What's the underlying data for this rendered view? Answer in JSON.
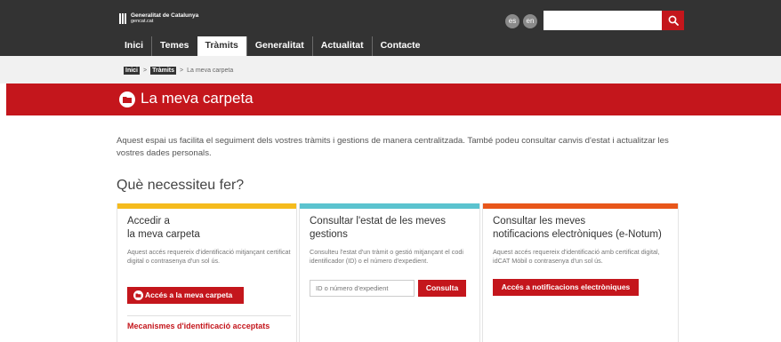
{
  "header": {
    "logo_line1": "Generalitat de Catalunya",
    "logo_line2": "gencat.cat",
    "lang_es": "es",
    "lang_en": "en",
    "search_placeholder": "",
    "nav": [
      "Inici",
      "Temes",
      "Tràmits",
      "Generalitat",
      "Actualitat",
      "Contacte"
    ],
    "nav_active": "Tràmits"
  },
  "breadcrumb": {
    "items": [
      "Inici",
      "Tràmits"
    ],
    "current": "La meva carpeta",
    "separator": ">"
  },
  "page": {
    "title": "La meva carpeta",
    "intro": "Aquest espai us facilita el seguiment dels vostres tràmits i gestions de manera centralitzada. També podeu consultar canvis d'estat i actualitzar les vostres dades personals.",
    "section_title": "Què necessiteu fer?"
  },
  "cards": [
    {
      "title": "Accedir a\nla meva carpeta",
      "description": "Aquest accés requereix d'identificació mitjançant certificat digital o contrasenya d'un sol ús.",
      "button_label": "Accés a la meva carpeta",
      "link_label": "Mecanismes d'identificació acceptats",
      "accent": "#f5bb1d"
    },
    {
      "title": "Consultar l'estat de les meves\ngestions",
      "description": "Consulteu l'estat d'un tràmit o gestió mitjançant el codi identificador (ID) o el número d'expedient.",
      "input_placeholder": "ID o número d'expedient",
      "button_label": "Consulta",
      "accent": "#5bc3cf"
    },
    {
      "title": "Consultar les meves\nnotificacions electròniques (e-Notum)",
      "description": "Aquest accés requereix d'identificació amb certificat digital, idCAT Mòbil o contrasenya d'un sol ús.",
      "button_label": "Accés a notificacions electròniques",
      "accent": "#e8561a"
    }
  ],
  "colors": {
    "brand_red": "#c4161c",
    "topbar": "#333333"
  }
}
